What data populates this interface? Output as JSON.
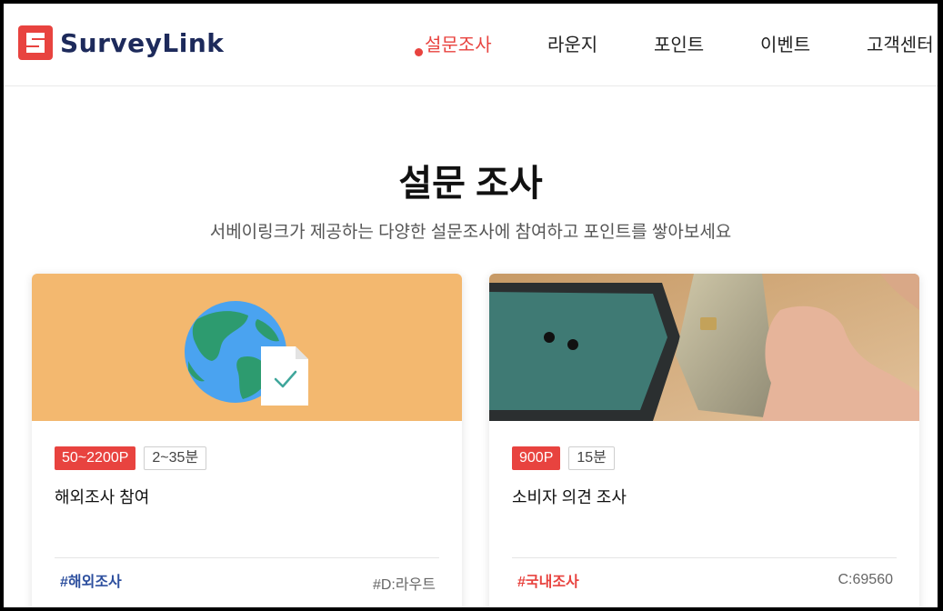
{
  "brand": {
    "name": "SurveyLink",
    "accent": "#e8433f",
    "text_color": "#1d2a5b"
  },
  "nav": {
    "items": [
      {
        "label": "설문조사",
        "active": true
      },
      {
        "label": "라운지",
        "active": false
      },
      {
        "label": "포인트",
        "active": false
      },
      {
        "label": "이벤트",
        "active": false
      },
      {
        "label": "고객센터",
        "active": false
      }
    ]
  },
  "page": {
    "title": "설문 조사",
    "subtitle": "서베이링크가 제공하는 다양한 설문조사에 참여하고 포인트를 쌓아보세요"
  },
  "cards": [
    {
      "image": "globe-document-illustration",
      "points": "50~2200P",
      "duration": "2~35분",
      "title": "해외조사 참여",
      "tag": "#해외조사",
      "tag_color": "#2d4f9e",
      "meta": "#D:라우트"
    },
    {
      "image": "credit-card-photo",
      "points": "900P",
      "duration": "15분",
      "title": "소비자 의견 조사",
      "tag": "#국내조사",
      "tag_color": "#e8433f",
      "meta": "C:69560"
    }
  ]
}
